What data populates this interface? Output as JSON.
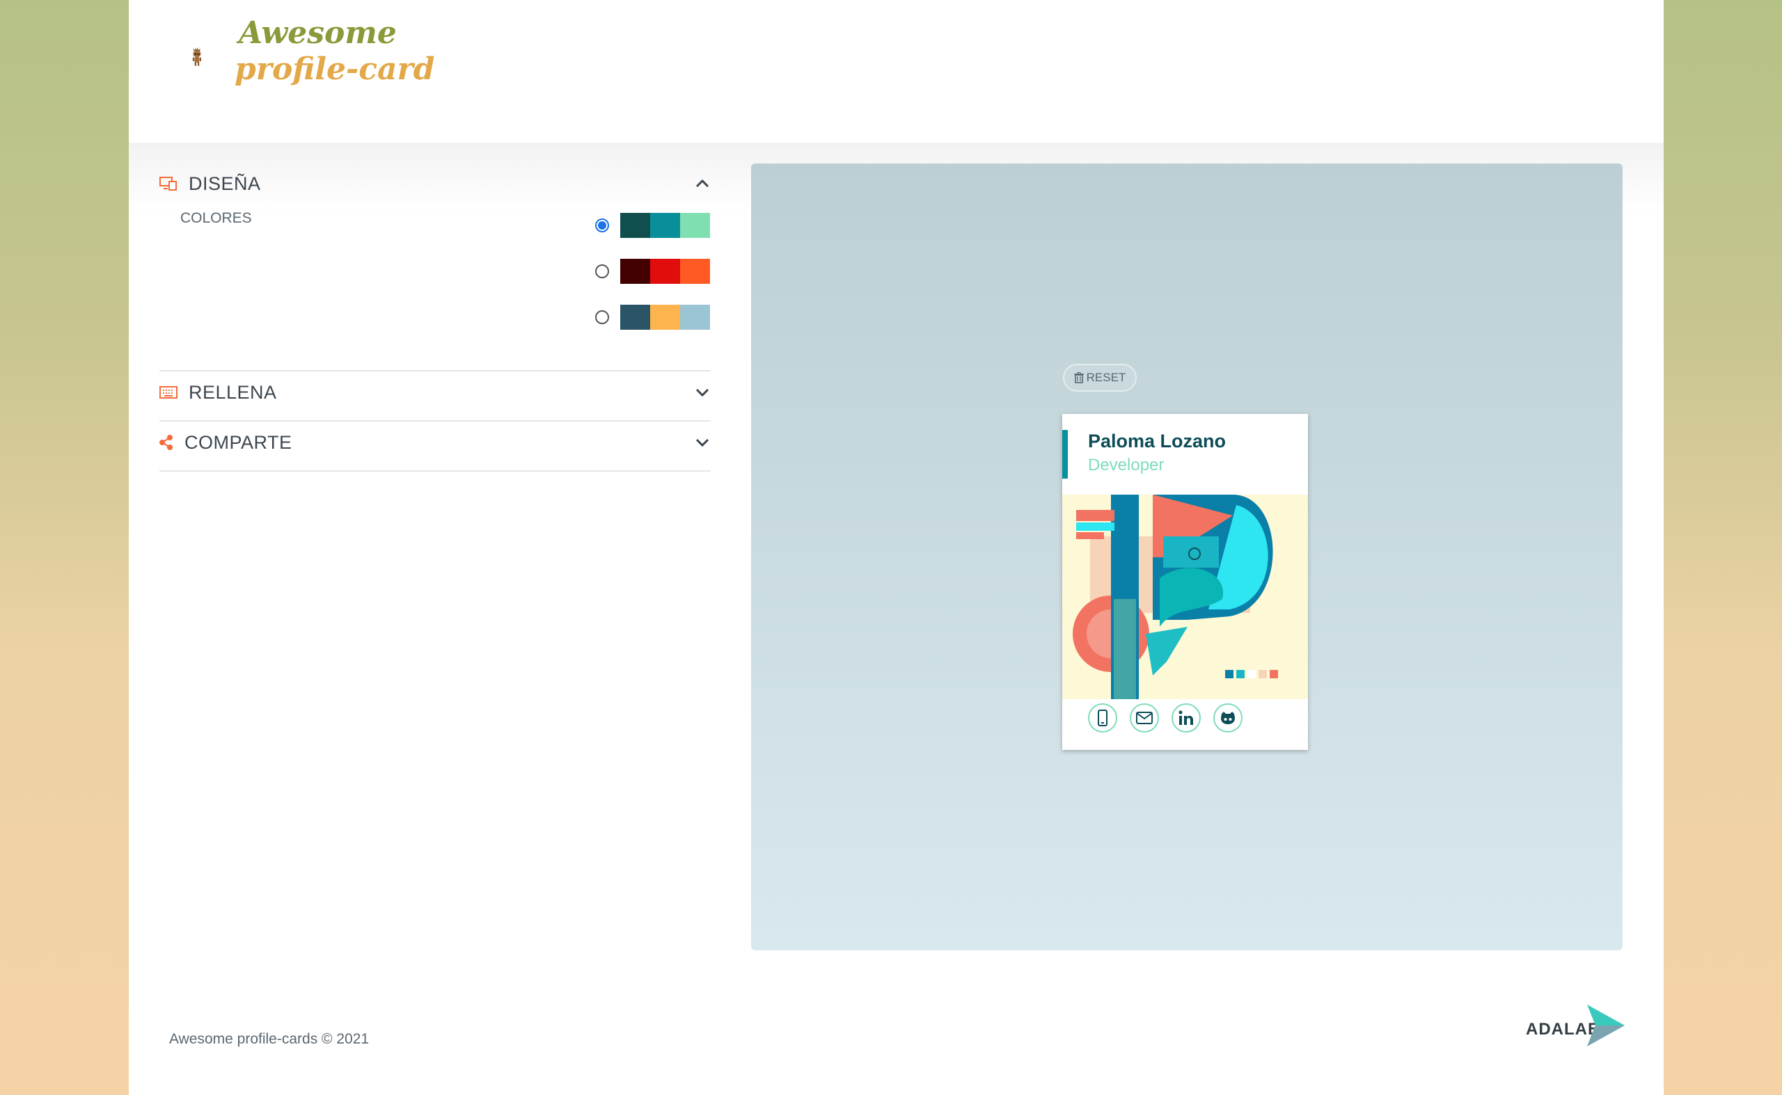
{
  "header": {
    "logo_line1": "Awesome",
    "logo_line2": "profile-card",
    "logo_icon": "groot-icon"
  },
  "sections": {
    "design": {
      "title": "DISEÑA",
      "icon": "design-icon",
      "expanded": true
    },
    "fill": {
      "title": "RELLENA",
      "icon": "keyboard-icon",
      "expanded": false
    },
    "share": {
      "title": "COMPARTE",
      "icon": "share-icon",
      "expanded": false
    }
  },
  "colors": {
    "label": "COLORES",
    "palettes": [
      {
        "selected": true,
        "swatches": [
          "#114e4e",
          "#0a8f9a",
          "#80dfb0"
        ]
      },
      {
        "selected": false,
        "swatches": [
          "#430000",
          "#e10c0c",
          "#ff5a24"
        ]
      },
      {
        "selected": false,
        "swatches": [
          "#2b5566",
          "#fdb34e",
          "#9bc5d4"
        ]
      }
    ]
  },
  "preview": {
    "reset_label": "RESET",
    "card": {
      "name": "Paloma Lozano",
      "job": "Developer",
      "social_icons": [
        "phone-icon",
        "mail-icon",
        "linkedin-icon",
        "github-icon"
      ]
    }
  },
  "footer": {
    "copyright": "Awesome profile-cards © 2021",
    "brand": "ADALAB"
  },
  "theme": {
    "accent": "#f26b38",
    "card_primary": "#0c4d57",
    "card_secondary": "#7fdcbb"
  }
}
